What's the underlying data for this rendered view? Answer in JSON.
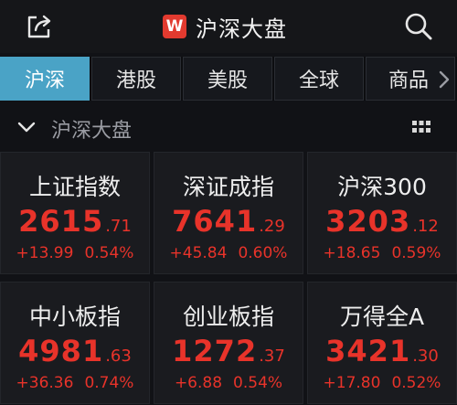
{
  "header": {
    "title": "沪深大盘",
    "brand_icon_text": "W",
    "share_icon": "share-icon",
    "search_icon": "search-icon"
  },
  "tabs": [
    {
      "label": "沪深",
      "active": true
    },
    {
      "label": "港股",
      "active": false
    },
    {
      "label": "美股",
      "active": false
    },
    {
      "label": "全球",
      "active": false
    },
    {
      "label": "商品",
      "active": false
    }
  ],
  "section": {
    "title": "沪深大盘",
    "collapse_icon": "chevron-down-icon",
    "view_icon": "grid-icon"
  },
  "colors": {
    "up": "#e8332a",
    "active_tab": "#4aa3c6",
    "brand": "#e23a2f"
  },
  "indices": [
    {
      "name": "上证指数",
      "price_int": "2615",
      "price_dec": ".71",
      "change": "+13.99",
      "pct": "0.54%"
    },
    {
      "name": "深证成指",
      "price_int": "7641",
      "price_dec": ".29",
      "change": "+45.84",
      "pct": "0.60%"
    },
    {
      "name": "沪深300",
      "price_int": "3203",
      "price_dec": ".12",
      "change": "+18.65",
      "pct": "0.59%"
    },
    {
      "name": "中小板指",
      "price_int": "4981",
      "price_dec": ".63",
      "change": "+36.36",
      "pct": "0.74%"
    },
    {
      "name": "创业板指",
      "price_int": "1272",
      "price_dec": ".37",
      "change": "+6.88",
      "pct": "0.54%"
    },
    {
      "name": "万得全A",
      "price_int": "3421",
      "price_dec": ".30",
      "change": "+17.80",
      "pct": "0.52%"
    }
  ]
}
